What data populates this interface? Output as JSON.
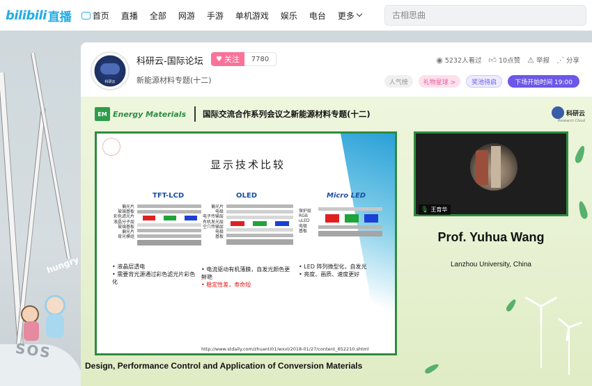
{
  "nav": {
    "logo_word": "bilibili",
    "logo_live": "直播",
    "items": [
      {
        "label": "首页"
      },
      {
        "label": "直播"
      },
      {
        "label": "全部"
      },
      {
        "label": "网游"
      },
      {
        "label": "手游"
      },
      {
        "label": "单机游戏"
      },
      {
        "label": "娱乐"
      },
      {
        "label": "电台"
      },
      {
        "label": "更多"
      }
    ],
    "search_placeholder": "古相思曲"
  },
  "scene": {
    "hungry_text": "hungry",
    "sos_text": "SOS"
  },
  "room": {
    "title": "科研云-国际论坛",
    "follow_label": "关注",
    "follower_count": "7780",
    "subtitle": "新能源材料专题(十二)",
    "avatar_text": "科研云",
    "stats": {
      "viewers": "5232人看过",
      "likes": "10点赞",
      "report": "举报",
      "share": "分享"
    },
    "tags": {
      "popularity": "人气榜",
      "gift": "礼物星球 >",
      "tip_badge": "奖池待启",
      "next": "下场开始时间 19:00"
    }
  },
  "video": {
    "em_badge": "EM",
    "journal": "Energy Materials",
    "title": "国际交流合作系列会议之新能源材料专题(十二)",
    "logo_text": "科研云",
    "logo_sub": "Research Cloud",
    "slide": {
      "title": "显示技术比较",
      "col_tft": "TFT-LCD",
      "col_oled": "OLED",
      "col_micro": "Micro LED",
      "tft_layers": [
        "偏光片",
        "玻璃基板",
        "彩色滤光片",
        "液晶分子层",
        "玻璃基板",
        "偏光片",
        "背光模组"
      ],
      "oled_layers": [
        "偏光片",
        "电极",
        "电子传输层",
        "有机发光层",
        "空穴传输层",
        "电极",
        "基板"
      ],
      "micro_layers": [
        "保护层",
        "RGB",
        "uLED",
        "电极",
        "基板"
      ],
      "tft_bullets": [
        "液晶层透电",
        "需要背光源通过彩色滤光片彩色化"
      ],
      "oled_bullets": [
        "电流驱动有机薄膜，自发光颜色更鲜艳"
      ],
      "oled_bullets_red": [
        "稳定性差，寿命短"
      ],
      "micro_bullets": [
        "LED 阵列微型化，自发光",
        "亮度、画质、速度更好"
      ],
      "url": "http://www.stdaily.com/zhuanti01/wxxl/2018-01/27/content_652210.shtml"
    },
    "cam_name": "王育华",
    "speaker_name": "Prof. Yuhua Wang",
    "speaker_affiliation": "Lanzhou University, China",
    "bottom_title": "Design, Performance Control and Application of Conversion Materials"
  },
  "colors": {
    "brand": "#23ade5",
    "follow": "#fb7299",
    "next_tag": "#6c57e8",
    "slide_border": "#2e8b3e"
  }
}
